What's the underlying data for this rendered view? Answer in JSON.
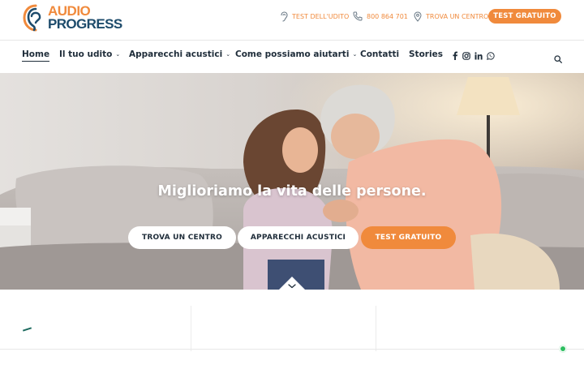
{
  "brand": {
    "line1": "AUDIO",
    "line2": "PROGRESS",
    "accent": "#f08a3c",
    "navy": "#1d4b6b"
  },
  "utility": {
    "hearing_test": "TEST DELL'UDITO",
    "phone": "800 864 701",
    "find_center": "TROVA UN CENTRO",
    "cta": "TEST GRATUITO"
  },
  "nav": {
    "items": [
      {
        "label": "Home",
        "dropdown": false
      },
      {
        "label": "Il tuo udito",
        "dropdown": true
      },
      {
        "label": "Apparecchi acustici",
        "dropdown": true
      },
      {
        "label": "Come possiamo aiutarti",
        "dropdown": true
      },
      {
        "label": "Contatti",
        "dropdown": false
      },
      {
        "label": "Stories",
        "dropdown": false
      }
    ],
    "chevron": "⌄",
    "social_icons": [
      "facebook-icon",
      "instagram-icon",
      "linkedin-icon",
      "whatsapp-icon"
    ],
    "search_icon": "search-icon"
  },
  "hero": {
    "title": "Miglioriamo la vita delle persone.",
    "buttons": [
      "TROVA UN CENTRO",
      "APPARECCHI ACUSTICI",
      "TEST GRATUITO"
    ]
  },
  "colors": {
    "text": "#1f2d3a",
    "whatsapp": "#2dbe60"
  }
}
